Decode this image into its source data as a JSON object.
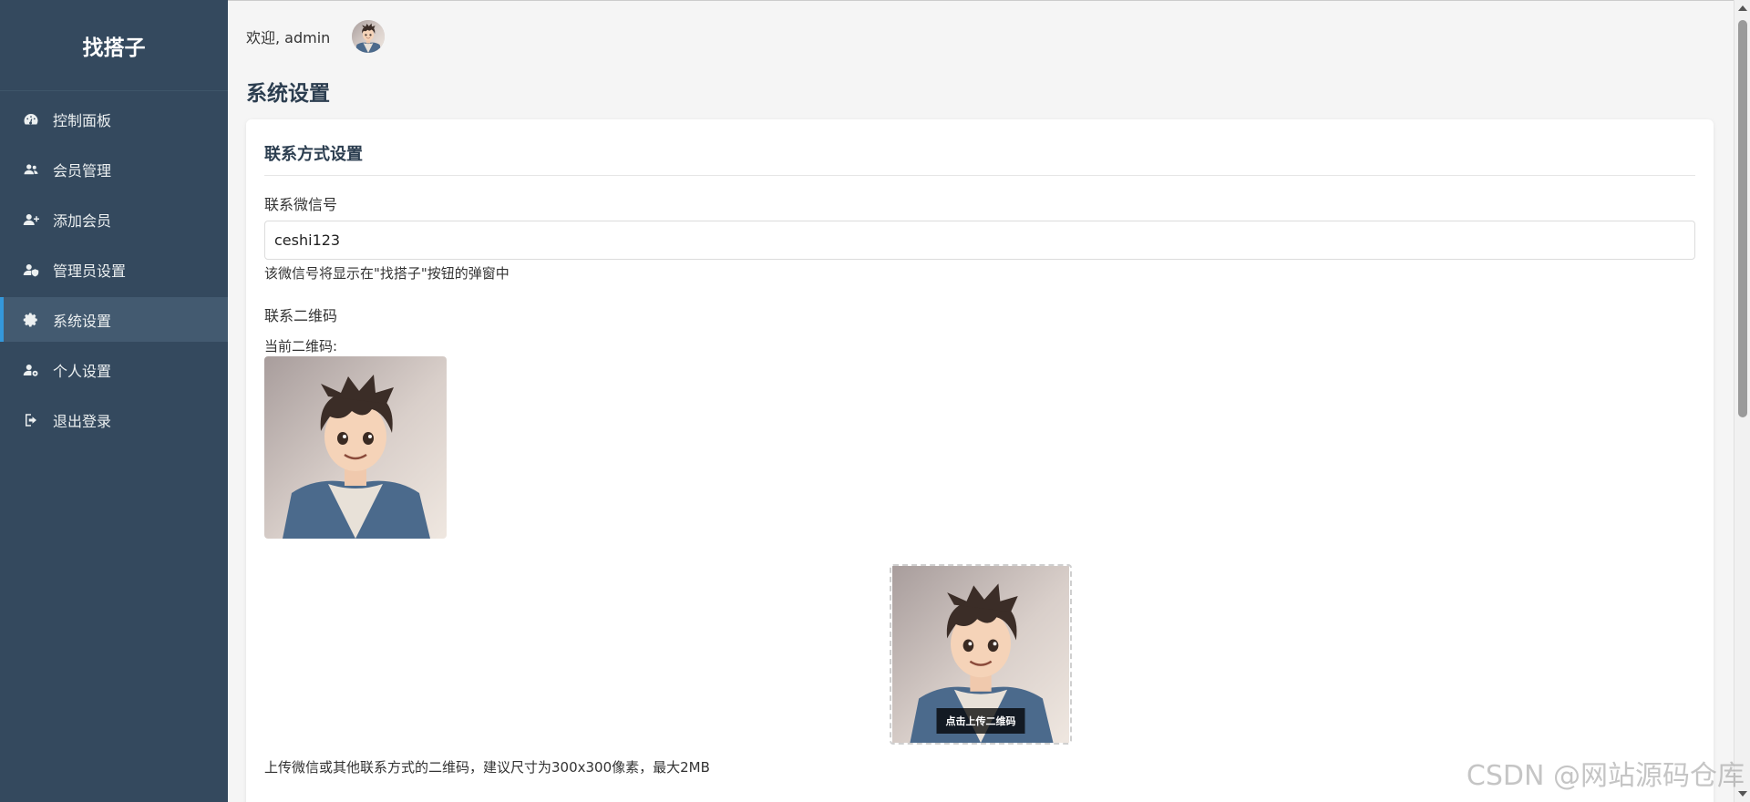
{
  "sidebar": {
    "brand": "找搭子",
    "items": [
      {
        "label": "控制面板",
        "icon": "dashboard-icon"
      },
      {
        "label": "会员管理",
        "icon": "users-icon"
      },
      {
        "label": "添加会员",
        "icon": "user-plus-icon"
      },
      {
        "label": "管理员设置",
        "icon": "user-shield-icon"
      },
      {
        "label": "系统设置",
        "icon": "gear-icon",
        "active": true
      },
      {
        "label": "个人设置",
        "icon": "user-cog-icon"
      },
      {
        "label": "退出登录",
        "icon": "sign-out-icon"
      }
    ]
  },
  "header": {
    "welcome": "欢迎, admin"
  },
  "page": {
    "title": "系统设置"
  },
  "contact": {
    "section_title": "联系方式设置",
    "wechat_label": "联系微信号",
    "wechat_value": "ceshi123",
    "wechat_hint": "该微信号将显示在\"找搭子\"按钮的弹窗中",
    "qr_label": "联系二维码",
    "qr_current_label": "当前二维码:",
    "upload_tip": "点击上传二维码",
    "qr_hint": "上传微信或其他联系方式的二维码，建议尺寸为300x300像素，最大2MB"
  },
  "watermark": "CSDN @网站源码仓库",
  "colors": {
    "sidebar_bg": "#34495e",
    "active_accent": "#3498db",
    "title": "#2c3e50"
  }
}
